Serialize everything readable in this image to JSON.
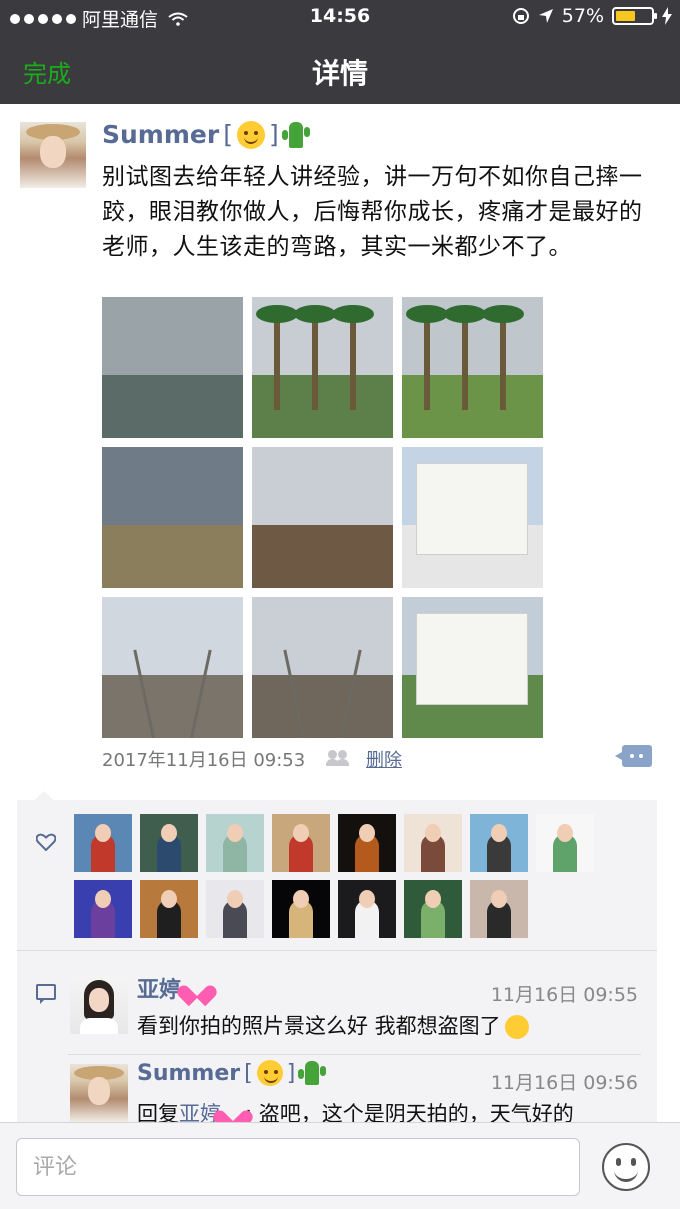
{
  "status_bar": {
    "carrier": "阿里通信",
    "time": "14:56",
    "battery_percent": "57%",
    "battery_level": 0.57
  },
  "nav": {
    "done_label": "完成",
    "title": "详情"
  },
  "post": {
    "author": "Summer",
    "text": "别试图去给年轻人讲经验，讲一万句不如你自己摔一跤，眼泪教你做人，后悔帮你成长，疼痛才是最好的老师，人生该走的弯路，其实一米都少不了。",
    "timestamp": "2017年11月16日 09:53",
    "delete_label": "删除",
    "photos": [
      {
        "icon": "rainy-window-photo",
        "sky": "#9aa3a8",
        "ground": "#5b6b68"
      },
      {
        "icon": "palm-trees-photo",
        "sky": "#c7cdd3",
        "ground": "#5d7f4a"
      },
      {
        "icon": "palm-garden-photo",
        "sky": "#bfc6cc",
        "ground": "#6c9448"
      },
      {
        "icon": "cloudy-river-photo",
        "sky": "#6f7b87",
        "ground": "#8b7e5c"
      },
      {
        "icon": "thatched-hut-photo",
        "sky": "#c8ced4",
        "ground": "#6e5a44"
      },
      {
        "icon": "white-building-photo",
        "sky": "#c4d4e4",
        "ground": "#e6e6e6"
      },
      {
        "icon": "railway-street-photo",
        "sky": "#d0d7de",
        "ground": "#7b746a"
      },
      {
        "icon": "railway-alley-photo",
        "sky": "#c9cfd4",
        "ground": "#6f675b"
      },
      {
        "icon": "hotel-building-photo",
        "sky": "#c2cdd8",
        "ground": "#5f8a4c"
      }
    ]
  },
  "likes": {
    "avatars": [
      {
        "icon": "city-tower-avatar",
        "bg": "#5b87b5",
        "body": "#c0392b"
      },
      {
        "icon": "couple-avatar",
        "bg": "#3f5e4e",
        "body": "#2c4a6e"
      },
      {
        "icon": "cartoon-girl-avatar",
        "bg": "#b7d3cf",
        "body": "#8fb5a4"
      },
      {
        "icon": "red-dress-avatar",
        "bg": "#c9a77d",
        "body": "#c0392b"
      },
      {
        "icon": "campfire-avatar",
        "bg": "#14100e",
        "body": "#b35a1c"
      },
      {
        "icon": "girl-portrait-avatar",
        "bg": "#efe3d8",
        "body": "#7a4b3a"
      },
      {
        "icon": "sea-view-avatar",
        "bg": "#7fb4d9",
        "body": "#3a3a3a"
      },
      {
        "icon": "green-bird-avatar",
        "bg": "#f7f7f7",
        "body": "#5fa36b"
      },
      {
        "icon": "purple-girl-avatar",
        "bg": "#3a3fb0",
        "body": "#6a3f9e"
      },
      {
        "icon": "smiling-man-avatar",
        "bg": "#b87a3c",
        "body": "#1f1f1f"
      },
      {
        "icon": "cartoon-boy-avatar",
        "bg": "#e8e8ec",
        "body": "#4a4a55"
      },
      {
        "icon": "deer-night-avatar",
        "bg": "#060608",
        "body": "#d6b57a"
      },
      {
        "icon": "white-dove-avatar",
        "bg": "#1b1b1d",
        "body": "#f2f2f2"
      },
      {
        "icon": "stream-rocks-avatar",
        "bg": "#2f5b3a",
        "body": "#7bb06a"
      },
      {
        "icon": "woman-standing-avatar",
        "bg": "#c9b7ac",
        "body": "#2a2a2a"
      }
    ]
  },
  "comments": [
    {
      "name": "亚婷",
      "time": "11月16日 09:55",
      "text": "看到你拍的照片景这么好 我都想盗图了"
    },
    {
      "name": "Summer",
      "time": "11月16日 09:56",
      "reply_prefix": "回复",
      "reply_to": "亚婷",
      "text": ": 盗吧，这个是阴天拍的，天气好的"
    }
  ],
  "input": {
    "placeholder": "评论"
  },
  "colors": {
    "nav_bg": "#3b3a3f",
    "accent_green": "#1aad19",
    "link_blue": "#576b95"
  }
}
